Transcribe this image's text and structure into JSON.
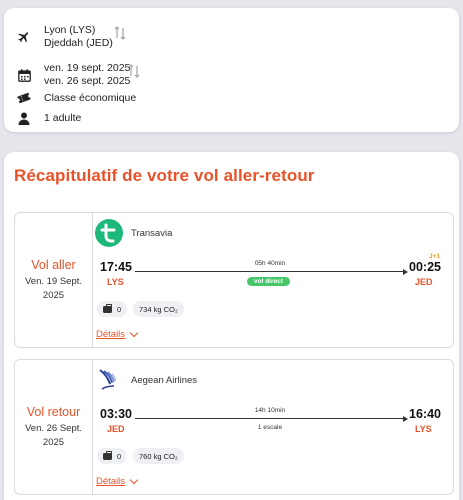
{
  "search": {
    "origin": "Lyon (LYS)",
    "destination": "Djeddah (JED)",
    "depart_date": "ven. 19 sept. 2025",
    "return_date": "ven. 26 sept. 2025",
    "cabin": "Classe économique",
    "passengers": "1 adulte"
  },
  "recap": {
    "title": "Récapitulatif de votre vol aller-retour",
    "legs": [
      {
        "direction": "Vol aller",
        "date_line1": "Ven. 19 Sept.",
        "date_line2": "2025",
        "airline": "Transavia",
        "dep_time": "17:45",
        "dep_code": "LYS",
        "arr_time": "00:25",
        "arr_code": "JED",
        "day_offset": "J+1",
        "duration": "05h 40min",
        "stops_label": "vol direct",
        "bags": "0",
        "co2": "734 kg CO₂",
        "details": "Détails"
      },
      {
        "direction": "Vol retour",
        "date_line1": "Ven. 26 Sept.",
        "date_line2": "2025",
        "airline": "Aegean Airlines",
        "dep_time": "03:30",
        "dep_code": "JED",
        "arr_time": "16:40",
        "arr_code": "LYS",
        "duration": "14h 10min",
        "stops_label": "1 escale",
        "bags": "0",
        "co2": "760 kg CO₂",
        "details": "Détails"
      }
    ]
  },
  "colors": {
    "accent": "#e8532a",
    "direct_badge": "#46c86a",
    "transavia": "#1db87a",
    "aegean": "#2a3d8f"
  },
  "icons": [
    "plane-icon",
    "swap-icon",
    "calendar-icon",
    "ticket-icon",
    "person-icon",
    "bag-icon",
    "chevron-down-icon"
  ]
}
